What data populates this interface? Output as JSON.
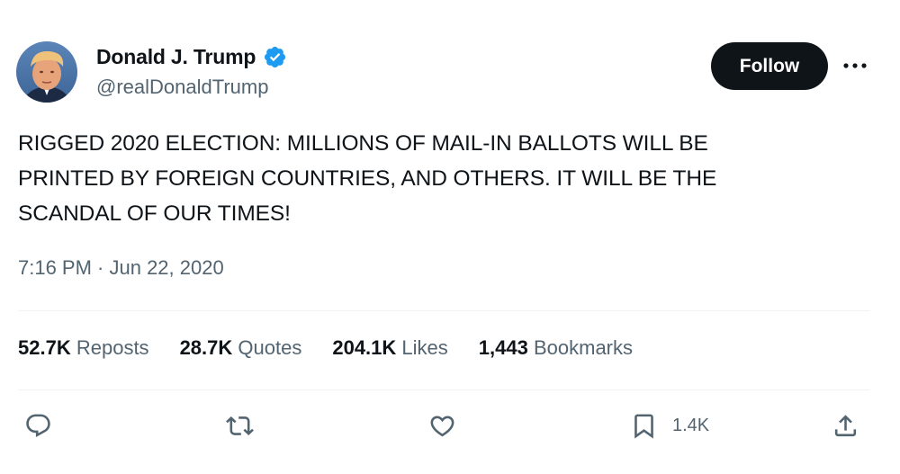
{
  "author": {
    "display_name": "Donald J. Trump",
    "handle": "@realDonaldTrump",
    "verified": true
  },
  "follow_label": "Follow",
  "tweet_text_lines": [
    "RIGGED 2020 ELECTION: MILLIONS OF MAIL-IN BALLOTS WILL BE",
    "PRINTED BY FOREIGN COUNTRIES, AND OTHERS. IT WILL BE THE",
    "SCANDAL OF OUR TIMES!"
  ],
  "timestamp": "7:16 PM · Jun 22, 2020",
  "stats": [
    {
      "count": "52.7K",
      "label": "Reposts"
    },
    {
      "count": "28.7K",
      "label": "Quotes"
    },
    {
      "count": "204.1K",
      "label": "Likes"
    },
    {
      "count": "1,443",
      "label": "Bookmarks"
    }
  ],
  "actions": {
    "bookmark_count": "1.4K"
  },
  "colors": {
    "verified_badge": "#1d9bf0",
    "secondary_text": "#536471",
    "primary_text": "#0f1419",
    "follow_button": "#0f1419",
    "divider": "#eff3f4"
  },
  "icons": [
    "verified-badge-icon",
    "more-icon",
    "reply-icon",
    "repost-icon",
    "like-icon",
    "bookmark-icon",
    "share-icon"
  ]
}
